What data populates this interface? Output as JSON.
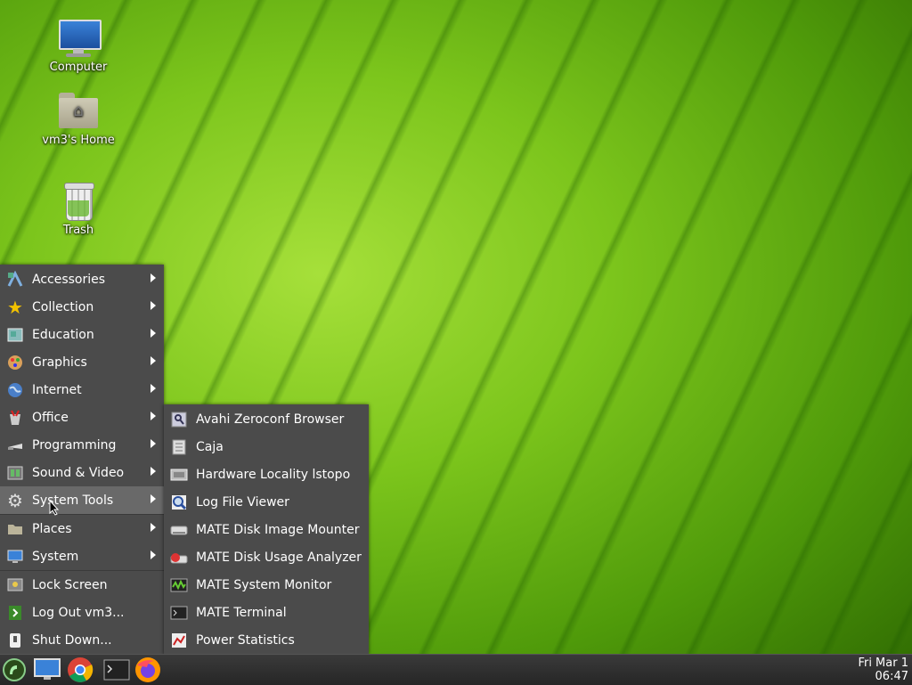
{
  "desktop": {
    "icons": [
      {
        "label": "Computer",
        "icon": "computer-icon"
      },
      {
        "label": "vm3's Home",
        "icon": "home-folder-icon"
      },
      {
        "label": "Trash",
        "icon": "trash-icon"
      }
    ]
  },
  "main_menu": {
    "items": [
      {
        "label": "Accessories",
        "icon": "accessories-icon",
        "submenu": true
      },
      {
        "label": "Collection",
        "icon": "star-icon",
        "submenu": true
      },
      {
        "label": "Education",
        "icon": "education-icon",
        "submenu": true
      },
      {
        "label": "Graphics",
        "icon": "graphics-icon",
        "submenu": true
      },
      {
        "label": "Internet",
        "icon": "globe-icon",
        "submenu": true
      },
      {
        "label": "Office",
        "icon": "office-icon",
        "submenu": true
      },
      {
        "label": "Programming",
        "icon": "programming-icon",
        "submenu": true
      },
      {
        "label": "Sound & Video",
        "icon": "multimedia-icon",
        "submenu": true
      },
      {
        "label": "System Tools",
        "icon": "gear-icon",
        "submenu": true,
        "active": true
      },
      {
        "label": "Places",
        "icon": "folder-icon",
        "submenu": true
      },
      {
        "label": "System",
        "icon": "system-icon",
        "submenu": true
      },
      {
        "label": "Lock Screen",
        "icon": "lock-icon",
        "submenu": false
      },
      {
        "label": "Log Out vm3...",
        "icon": "logout-icon",
        "submenu": false
      },
      {
        "label": "Shut Down...",
        "icon": "shutdown-icon",
        "submenu": false
      }
    ]
  },
  "system_tools_menu": {
    "items": [
      {
        "label": "Avahi Zeroconf Browser",
        "icon": "network-browse-icon"
      },
      {
        "label": "Caja",
        "icon": "file-manager-icon"
      },
      {
        "label": "Hardware Locality lstopo",
        "icon": "hardware-icon"
      },
      {
        "label": "Log File Viewer",
        "icon": "log-viewer-icon"
      },
      {
        "label": "MATE Disk Image Mounter",
        "icon": "disk-image-icon"
      },
      {
        "label": "MATE Disk Usage Analyzer",
        "icon": "disk-usage-icon"
      },
      {
        "label": "MATE System Monitor",
        "icon": "system-monitor-icon"
      },
      {
        "label": "MATE Terminal",
        "icon": "terminal-icon"
      },
      {
        "label": "Power Statistics",
        "icon": "power-stats-icon"
      }
    ]
  },
  "taskbar": {
    "launchers": [
      {
        "icon": "menu-launcher-icon"
      },
      {
        "icon": "show-desktop-icon"
      },
      {
        "icon": "chrome-icon"
      },
      {
        "icon": "terminal-icon"
      },
      {
        "icon": "firefox-icon"
      }
    ],
    "clock": {
      "date": "Fri Mar 1",
      "time": "06:47"
    }
  },
  "colors": {
    "menu_bg": "#4b4b4b",
    "menu_active": "#696969",
    "taskbar_bg": "#2e2e2e"
  }
}
